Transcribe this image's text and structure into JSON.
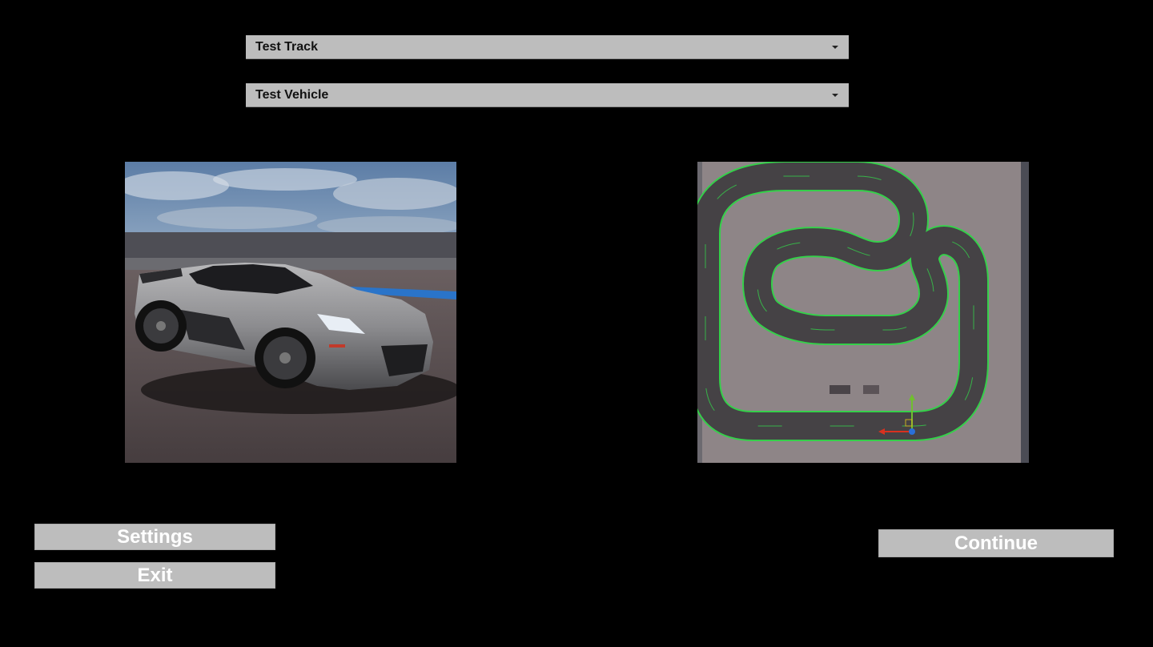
{
  "track_select": {
    "selected": "Test Track",
    "icon": "chevron-down-icon"
  },
  "vehicle_select": {
    "selected": "Test Vehicle",
    "icon": "chevron-down-icon"
  },
  "buttons": {
    "settings": "Settings",
    "exit": "Exit",
    "continue": "Continue"
  },
  "colors": {
    "background": "#000000",
    "control_gray": "#bdbdbd",
    "track_edge_green": "#35d04a"
  }
}
